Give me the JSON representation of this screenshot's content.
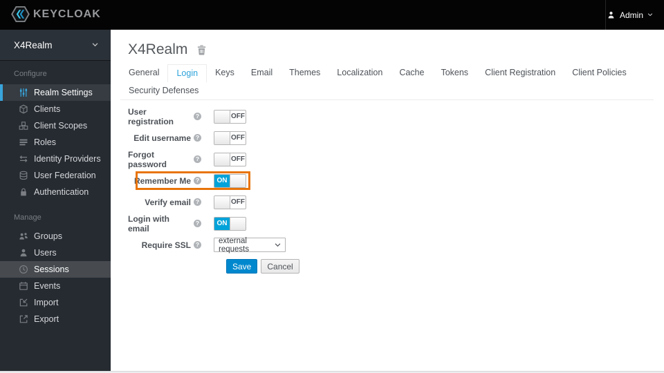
{
  "header": {
    "brand": "KEYCLOAK",
    "user_menu": {
      "label": "Admin"
    }
  },
  "sidebar": {
    "realm_label": "X4Realm",
    "sections": [
      {
        "label": "Configure",
        "items": [
          {
            "label": "Realm Settings",
            "icon": "sliders-icon",
            "active": true
          },
          {
            "label": "Clients",
            "icon": "cube-icon"
          },
          {
            "label": "Client Scopes",
            "icon": "cubes-icon"
          },
          {
            "label": "Roles",
            "icon": "list-icon"
          },
          {
            "label": "Identity Providers",
            "icon": "exchange-arrows-icon"
          },
          {
            "label": "User Federation",
            "icon": "database-icon"
          },
          {
            "label": "Authentication",
            "icon": "lock-icon"
          }
        ]
      },
      {
        "label": "Manage",
        "items": [
          {
            "label": "Groups",
            "icon": "group-icon"
          },
          {
            "label": "Users",
            "icon": "user-icon"
          },
          {
            "label": "Sessions",
            "icon": "clock-icon",
            "hovered": true
          },
          {
            "label": "Events",
            "icon": "calendar-icon"
          },
          {
            "label": "Import",
            "icon": "import-icon"
          },
          {
            "label": "Export",
            "icon": "export-icon"
          }
        ]
      }
    ]
  },
  "main": {
    "title": "X4Realm",
    "title_icon": "trash-icon",
    "tabs": [
      "General",
      "Login",
      "Keys",
      "Email",
      "Themes",
      "Localization",
      "Cache",
      "Tokens",
      "Client Registration",
      "Client Policies",
      "Security Defenses"
    ],
    "active_tab": "Login",
    "form": {
      "rows": [
        {
          "label": "User registration",
          "type": "toggle",
          "value": "OFF"
        },
        {
          "label": "Edit username",
          "type": "toggle",
          "value": "OFF"
        },
        {
          "label": "Forgot password",
          "type": "toggle",
          "value": "OFF"
        },
        {
          "label": "Remember Me",
          "type": "toggle",
          "value": "ON",
          "highlighted": true
        },
        {
          "label": "Verify email",
          "type": "toggle",
          "value": "OFF"
        },
        {
          "label": "Login with email",
          "type": "toggle",
          "value": "ON"
        },
        {
          "label": "Require SSL",
          "type": "select",
          "value": "external requests"
        }
      ],
      "save_label": "Save",
      "cancel_label": "Cancel"
    }
  },
  "colors": {
    "header_bg": "#040404",
    "sidebar_bg": "#262b32",
    "nav_active_accent": "#39a5dc",
    "toggle_on_blue": "#00a3d9",
    "save_button_blue": "#0088ce",
    "highlight_orange": "#e87408",
    "active_tab_blue": "#2ba2da"
  }
}
